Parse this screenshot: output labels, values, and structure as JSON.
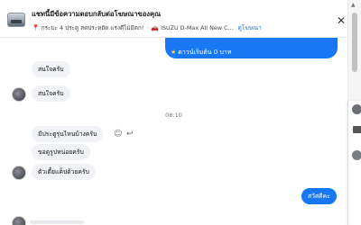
{
  "header": {
    "title": "แชทนี้มีข้อความตอบกลับต่อโฆษณาของคุณ",
    "location": "กระบะ 4 ประตู สดประหยัด แรงดีไม่มีตก!",
    "vehicle": "ISUZU D-Max All New C...",
    "link_label": "ดูโฆษณา"
  },
  "ad_bubble": {
    "text": "ดาวน์เริ่มต้น 0 บาท"
  },
  "messages": {
    "m1": "สนใจครับ",
    "m2": "สนใจครับ",
    "timestamp": "08:10",
    "m3": "มีประตูรุ่นไหนบ้างครับ",
    "m4": "ขอดูรูปหน่อยครับ",
    "m5": "ตัวเตี้ยแค็ปด้วยครับ",
    "outgoing": "สวัสดีคะ"
  },
  "icons": {
    "close": "close-icon",
    "pin": "map-pin-icon",
    "car": "car-icon",
    "star": "star-icon",
    "react": "smile-icon",
    "reply": "reply-icon"
  },
  "colors": {
    "accent": "#1877f2",
    "incoming_bubble": "#f0f2f5",
    "outgoing_text": "#ffffff"
  }
}
